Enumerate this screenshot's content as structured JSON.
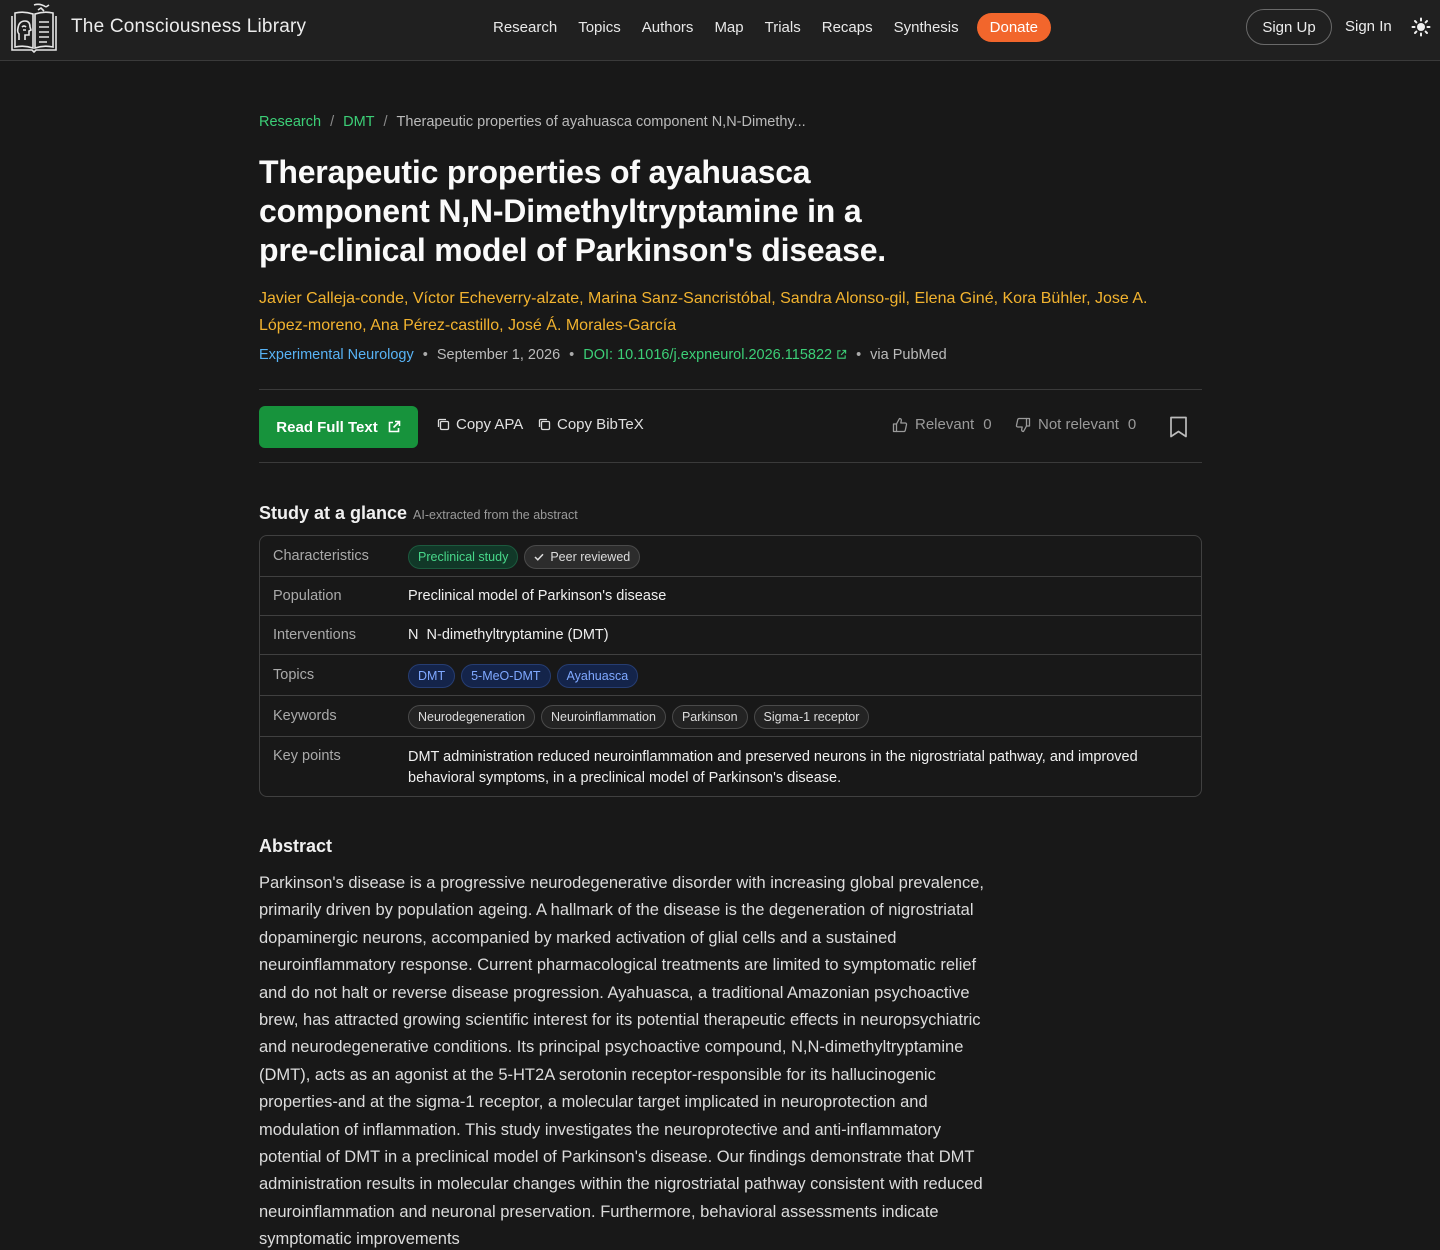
{
  "nav": {
    "brand": "The Consciousness Library",
    "links": [
      "Research",
      "Topics",
      "Authors",
      "Map",
      "Trials",
      "Recaps",
      "Synthesis"
    ],
    "donate": "Donate",
    "sign_up": "Sign Up",
    "sign_in": "Sign In"
  },
  "breadcrumb": {
    "items": [
      "Research",
      "DMT"
    ],
    "current": "Therapeutic properties of ayahuasca component N,N-Dimethy..."
  },
  "article": {
    "title": "Therapeutic properties of ayahuasca component N,N-Dimethyltryptamine in a pre-clinical model of Parkinson's disease.",
    "authors": [
      "Javier Calleja-conde",
      "Víctor Echeverry-alzate",
      "Marina Sanz-Sancristóbal",
      "Sandra Alonso-gil",
      "Elena Giné",
      "Kora Bühler",
      "Jose A. López-moreno",
      "Ana Pérez-castillo",
      "José Á. Morales-García"
    ],
    "journal": "Experimental Neurology",
    "date": "September 1, 2026",
    "doi": "DOI: 10.1016/j.expneurol.2026.115822",
    "source": "via PubMed"
  },
  "actions": {
    "read_full_text": "Read Full Text",
    "copy_apa": "Copy APA",
    "copy_bibtex": "Copy BibTeX",
    "relevant_label": "Relevant",
    "relevant_count": "0",
    "not_relevant_label": "Not relevant",
    "not_relevant_count": "0"
  },
  "glance": {
    "heading": "Study at a glance",
    "subheading": "AI-extracted from the abstract",
    "characteristics_label": "Characteristics",
    "characteristics": [
      "Preclinical study",
      "Peer reviewed"
    ],
    "population_label": "Population",
    "population": "Preclinical model of Parkinson's disease",
    "interventions_label": "Interventions",
    "interventions": "N  N-dimethyltryptamine (DMT)",
    "topics_label": "Topics",
    "topics": [
      "DMT",
      "5-MeO-DMT",
      "Ayahuasca"
    ],
    "keywords_label": "Keywords",
    "keywords": [
      "Neurodegeneration",
      "Neuroinflammation",
      "Parkinson",
      "Sigma-1 receptor"
    ],
    "key_points_label": "Key points",
    "key_points": "DMT administration reduced neuroinflammation and preserved neurons in the nigrostriatal pathway, and improved behavioral symptoms, in a preclinical model of Parkinson's disease."
  },
  "abstract": {
    "heading": "Abstract",
    "text": "Parkinson's disease is a progressive neurodegenerative disorder with increasing global prevalence, primarily driven by population ageing. A hallmark of the disease is the degeneration of nigrostriatal dopaminergic neurons, accompanied by marked activation of glial cells and a sustained neuroinflammatory response. Current pharmacological treatments are limited to symptomatic relief and do not halt or reverse disease progression. Ayahuasca, a traditional Amazonian psychoactive brew, has attracted growing scientific interest for its potential therapeutic effects in neuropsychiatric and neurodegenerative conditions. Its principal psychoactive compound, N,N-dimethyltryptamine (DMT), acts as an agonist at the 5-HT2A serotonin receptor-responsible for its hallucinogenic properties-and at the sigma-1 receptor, a molecular target implicated in neuroprotection and modulation of inflammation. This study investigates the neuroprotective and anti-inflammatory potential of DMT in a preclinical model of Parkinson's disease. Our findings demonstrate that DMT administration results in molecular changes within the nigrostriatal pathway consistent with reduced neuroinflammation and neuronal preservation. Furthermore, behavioral assessments indicate symptomatic improvements"
  },
  "colors": {
    "background": "#181818",
    "link_green": "#3ccf77",
    "author_gold": "#f2b32f",
    "journal_blue": "#58b3f5",
    "donate_orange": "#f2662c",
    "read_button_green": "#17933c"
  }
}
